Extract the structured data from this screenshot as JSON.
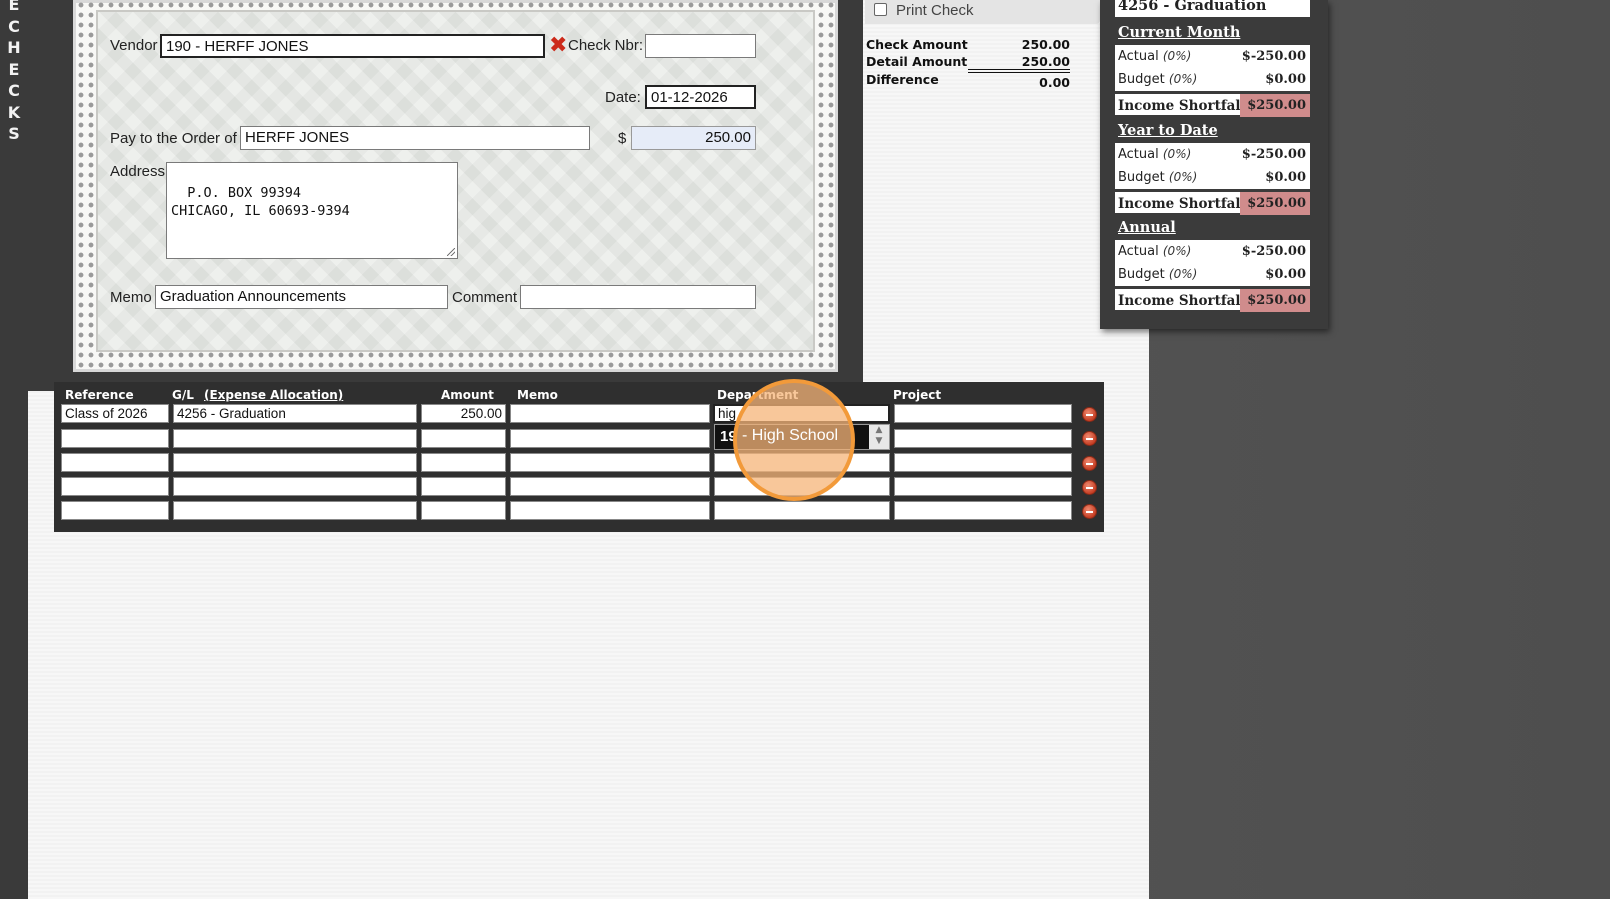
{
  "sidebar": {
    "vertical_label": "E\nC\nH\nE\nC\nK\nS"
  },
  "check": {
    "vendor_label": "Vendor",
    "vendor_value": "190 - HERFF JONES",
    "check_nbr_label": "Check Nbr:",
    "check_nbr_value": "",
    "date_label": "Date:",
    "date_value": "01-12-2026",
    "pay_to_label": "Pay to the Order of",
    "pay_to_value": "HERFF JONES",
    "currency_symbol": "$",
    "amount_value": "250.00",
    "address_label": "Address",
    "address_value": "P.O. BOX 99394\nCHICAGO, IL 60693-9394",
    "memo_label": "Memo",
    "memo_value": "Graduation Announcements",
    "comment_label": "Comment",
    "comment_value": ""
  },
  "summary": {
    "print_check_label": "Print Check",
    "print_check_checked": false,
    "check_amount_label": "Check Amount",
    "check_amount_value": "250.00",
    "detail_amount_label": "Detail Amount",
    "detail_amount_value": "250.00",
    "difference_label": "Difference",
    "difference_value": "0.00"
  },
  "budget": {
    "account": "4256 - Graduation",
    "shortfall_color": "#d08c8c",
    "sections": [
      {
        "title": "Current Month",
        "actual_label": "Actual",
        "actual_pct": "(0%)",
        "actual_value": "$-250.00",
        "budget_label": "Budget",
        "budget_pct": "(0%)",
        "budget_value": "$0.00",
        "shortfall_label": "Income Shortfall",
        "shortfall_value": "$250.00"
      },
      {
        "title": "Year to Date",
        "actual_label": "Actual",
        "actual_pct": "(0%)",
        "actual_value": "$-250.00",
        "budget_label": "Budget",
        "budget_pct": "(0%)",
        "budget_value": "$0.00",
        "shortfall_label": "Income Shortfall",
        "shortfall_value": "$250.00"
      },
      {
        "title": "Annual",
        "actual_label": "Actual",
        "actual_pct": "(0%)",
        "actual_value": "$-250.00",
        "budget_label": "Budget",
        "budget_pct": "(0%)",
        "budget_value": "$0.00",
        "shortfall_label": "Income Shortfall",
        "shortfall_value": "$250.00"
      }
    ]
  },
  "detail": {
    "headers": {
      "reference": "Reference",
      "gl": "G/L",
      "expense_allocation": "(Expense Allocation)",
      "amount": "Amount",
      "memo": "Memo",
      "department": "Department",
      "project": "Project"
    },
    "rows": [
      {
        "reference": "Class of 2026",
        "gl": "4256 - Graduation",
        "amount": "250.00",
        "memo": "",
        "department": "hig",
        "project": ""
      },
      {
        "reference": "",
        "gl": "",
        "amount": "",
        "memo": "",
        "department": "",
        "project": ""
      },
      {
        "reference": "",
        "gl": "",
        "amount": "",
        "memo": "",
        "department": "",
        "project": ""
      },
      {
        "reference": "",
        "gl": "",
        "amount": "",
        "memo": "",
        "department": "",
        "project": ""
      },
      {
        "reference": "",
        "gl": "",
        "amount": "",
        "memo": "",
        "department": "",
        "project": ""
      }
    ],
    "department_suggestion": "19 - High School",
    "department_suggestion_prefix": "19",
    "department_suggestion_text": "- High School"
  },
  "colors": {
    "highlight": "#f29a3a",
    "remove_button": "#c2391f"
  },
  "icons": {
    "remove": "minus-circle-icon",
    "vendor_clear": "x-icon"
  }
}
